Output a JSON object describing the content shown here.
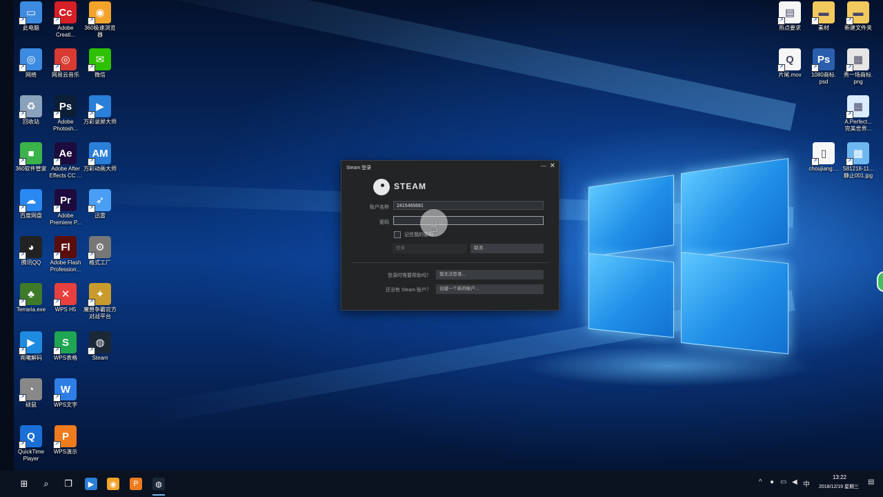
{
  "desktop_icons_left": [
    {
      "label": "此电脑",
      "icon": "computer-icon",
      "color": "#3d8be0"
    },
    {
      "label": "Adobe\nCreati...",
      "icon": "adobe-cc-icon",
      "color": "#d71f26"
    },
    {
      "label": "360极速浏览\n器",
      "icon": "360-browser-icon",
      "color": "#f3a32a"
    },
    {
      "label": "网络",
      "icon": "network-icon",
      "color": "#3d8be0"
    },
    {
      "label": "网易云音乐",
      "icon": "netease-music-icon",
      "color": "#d93a31"
    },
    {
      "label": "微信",
      "icon": "wechat-icon",
      "color": "#2dc100"
    },
    {
      "label": "回收站",
      "icon": "recycle-bin-icon",
      "color": "#8aa2bc"
    },
    {
      "label": "Adobe\nPhotosh...",
      "icon": "photoshop-icon",
      "color": "#0a1f36"
    },
    {
      "label": "万彩录屏大师",
      "icon": "wancai-recorder-icon",
      "color": "#2a7fd8"
    },
    {
      "label": "360软件管家",
      "icon": "360-software-icon",
      "color": "#3bb34a"
    },
    {
      "label": "Adobe After\nEffects CC ...",
      "icon": "after-effects-icon",
      "color": "#1d0b3d"
    },
    {
      "label": "万彩动画大师",
      "icon": "wancai-animation-icon",
      "color": "#2a7fd8"
    },
    {
      "label": "百度网盘",
      "icon": "baidu-netdisk-icon",
      "color": "#2a89f0"
    },
    {
      "label": "Adobe\nPremiere P...",
      "icon": "premiere-icon",
      "color": "#1d0b3d"
    },
    {
      "label": "迅雷",
      "icon": "xunlei-icon",
      "color": "#4a9ff5"
    },
    {
      "label": "腾讯QQ",
      "icon": "qq-icon",
      "color": "#222"
    },
    {
      "label": "Adobe Flash\nProfession...",
      "icon": "flash-icon",
      "color": "#5a0d0d"
    },
    {
      "label": "格式工厂",
      "icon": "format-factory-icon",
      "color": "#777"
    },
    {
      "label": "Terraria.exe",
      "icon": "terraria-icon",
      "color": "#3e7a2a"
    },
    {
      "label": "WPS H5",
      "icon": "wps-h5-icon",
      "color": "#e8403e"
    },
    {
      "label": "魔兽争霸官方\n对战平台",
      "icon": "warcraft-platform-icon",
      "color": "#c89b2c"
    },
    {
      "label": "亮曦解码",
      "icon": "decoder-icon",
      "color": "#1f8be0"
    },
    {
      "label": "WPS表格",
      "icon": "wps-sheets-icon",
      "color": "#1fa653"
    },
    {
      "label": "Steam",
      "icon": "steam-icon",
      "color": "#1b2838"
    },
    {
      "label": "硕鼠",
      "icon": "shuoshu-icon",
      "color": "#888"
    },
    {
      "label": "WPS文字",
      "icon": "wps-writer-icon",
      "color": "#2f7ee6"
    },
    {
      "label": "QuickTime\nPlayer",
      "icon": "quicktime-icon",
      "color": "#1a6fd6"
    },
    {
      "label": "WPS演示",
      "icon": "wps-presentation-icon",
      "color": "#ef7b1f"
    }
  ],
  "desktop_icons_right": [
    {
      "label": "热点要求",
      "icon": "document-icon",
      "color": "#f6f6f6"
    },
    {
      "label": "素材",
      "icon": "folder-icon",
      "color": "#f1c95e"
    },
    {
      "label": "新建文件夹",
      "icon": "folder-icon",
      "color": "#f1c95e"
    },
    {
      "label": "片尾.mov",
      "icon": "quicktime-file-icon",
      "color": "#f6f6f6"
    },
    {
      "label": "1080商标.\npsd",
      "icon": "psd-file-icon",
      "color": "#2b5fad"
    },
    {
      "label": "秀一场商标.\npng",
      "icon": "png-file-icon",
      "color": "#e6e6e6"
    },
    {
      "label": "A.Perfect...\n完美世界...",
      "icon": "image-file-icon",
      "color": "#dcecff"
    },
    {
      "label": "choujiang....",
      "icon": "blank-file-icon",
      "color": "#f6f6f6"
    },
    {
      "label": "S81218-11...\n静止001.jpg",
      "icon": "jpg-file-icon",
      "color": "#6fb8ef"
    }
  ],
  "dialog": {
    "title": "Steam 登录",
    "min": "—",
    "close": "✕",
    "brand": "STEAM",
    "account_label": "账户名称",
    "account_value": "2415465681",
    "password_label": "密码",
    "password_value": "",
    "remember_label": "记住我的密码",
    "login_button": "登录",
    "cancel_button": "取消",
    "help_question": "登录时需要帮助吗？",
    "help_button": "我无法登录...",
    "create_question": "还没有 Steam 账户？",
    "create_button": "创建一个新的帐户..."
  },
  "taskbar": {
    "pinned": [
      {
        "icon": "windows-start-icon"
      },
      {
        "icon": "search-icon"
      },
      {
        "icon": "task-view-icon"
      },
      {
        "icon": "wancai-taskbar-icon",
        "color": "#2a7fd8"
      },
      {
        "icon": "360-browser-taskbar-icon",
        "color": "#f3a32a"
      },
      {
        "icon": "wps-taskbar-icon",
        "color": "#ef7b1f"
      },
      {
        "icon": "steam-taskbar-icon",
        "color": "#1b2838"
      }
    ],
    "tray": {
      "up_arrow": "^",
      "ime": "中",
      "time": "13:22",
      "date": "2018/12/19 星期三"
    }
  }
}
